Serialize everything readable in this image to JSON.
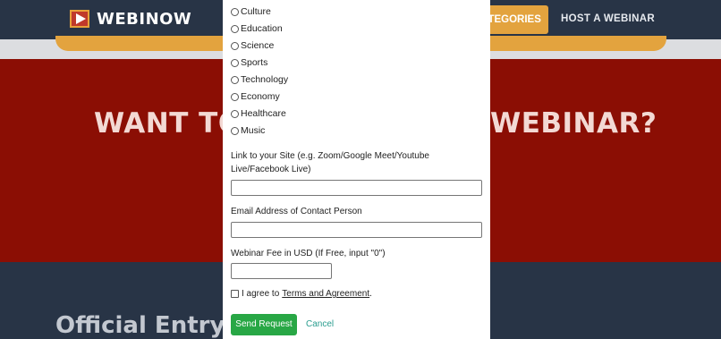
{
  "brand": {
    "name": "WEBINOW"
  },
  "nav": {
    "categories": "ATEGORIES",
    "host": "HOST A WEBINAR"
  },
  "hero": {
    "left_text": "WANT TO",
    "right_text": "WEBINAR?"
  },
  "section": {
    "title": "Official Entry to"
  },
  "colors": {
    "navbar": "#283446",
    "hero": "#8b0e04",
    "accent": "#e3a33e",
    "send": "#28a745",
    "cancel": "#2a9d8f"
  },
  "modal": {
    "categories": [
      {
        "label": "Culture"
      },
      {
        "label": "Education"
      },
      {
        "label": "Science"
      },
      {
        "label": "Sports"
      },
      {
        "label": "Technology"
      },
      {
        "label": "Economy"
      },
      {
        "label": "Healthcare"
      },
      {
        "label": "Music"
      }
    ],
    "link_label": "Link to your Site (e.g. Zoom/Google Meet/Youtube Live/Facebook Live)",
    "link_value": "",
    "email_label": "Email Address of Contact Person",
    "email_value": "",
    "fee_label": "Webinar Fee in USD (If Free, input \"0\")",
    "fee_value": "",
    "agree_text": "I agree to",
    "terms_link": "Terms and Agreement",
    "agree_end": ".",
    "send_label": "Send Request",
    "cancel_label": "Cancel"
  }
}
